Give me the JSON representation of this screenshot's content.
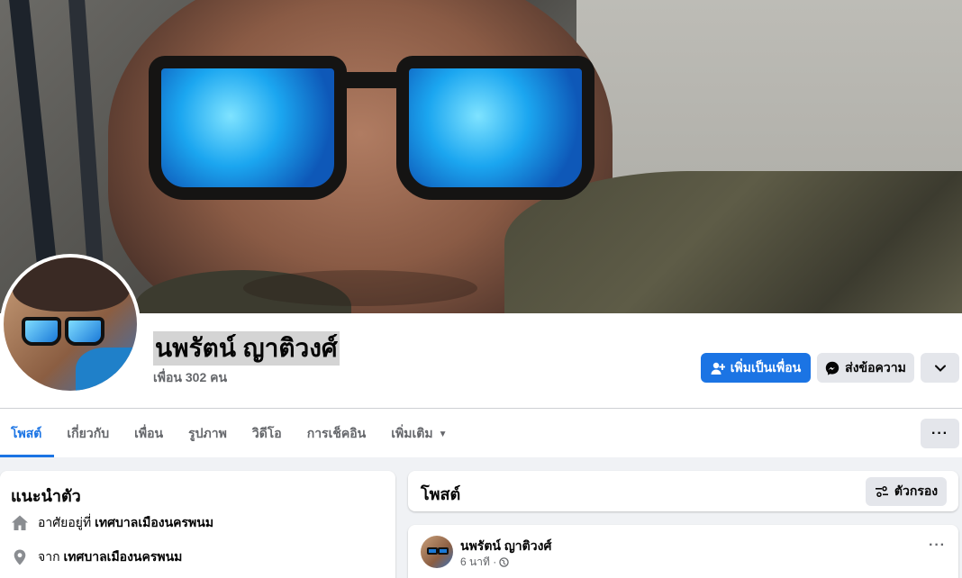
{
  "profile": {
    "name": "นพรัตน์ ญาติวงศ์",
    "friends": "เพื่อน 302 คน"
  },
  "actions": {
    "add_friend": "เพิ่มเป็นเพื่อน",
    "message": "ส่งข้อความ"
  },
  "tabs": [
    {
      "label": "โพสต์"
    },
    {
      "label": "เกี่ยวกับ"
    },
    {
      "label": "เพื่อน"
    },
    {
      "label": "รูปภาพ"
    },
    {
      "label": "วิดีโอ"
    },
    {
      "label": "การเช็คอิน"
    },
    {
      "label": "เพิ่มเติม"
    }
  ],
  "intro": {
    "title": "แนะนำตัว",
    "lives_prefix": "อาศัยอยู่ที่",
    "lives_value": "เทศบาลเมืองนครพนม",
    "from_prefix": "จาก",
    "from_value": "เทศบาลเมืองนครพนม"
  },
  "posts": {
    "title": "โพสต์",
    "filter_label": "ตัวกรอง",
    "first": {
      "author": "นพรัตน์ ญาติวงศ์",
      "time": "6 นาที ·"
    }
  },
  "colors": {
    "accent": "#1b74e4",
    "secondary_button": "#e4e6eb",
    "page_bg": "#f0f2f5"
  }
}
